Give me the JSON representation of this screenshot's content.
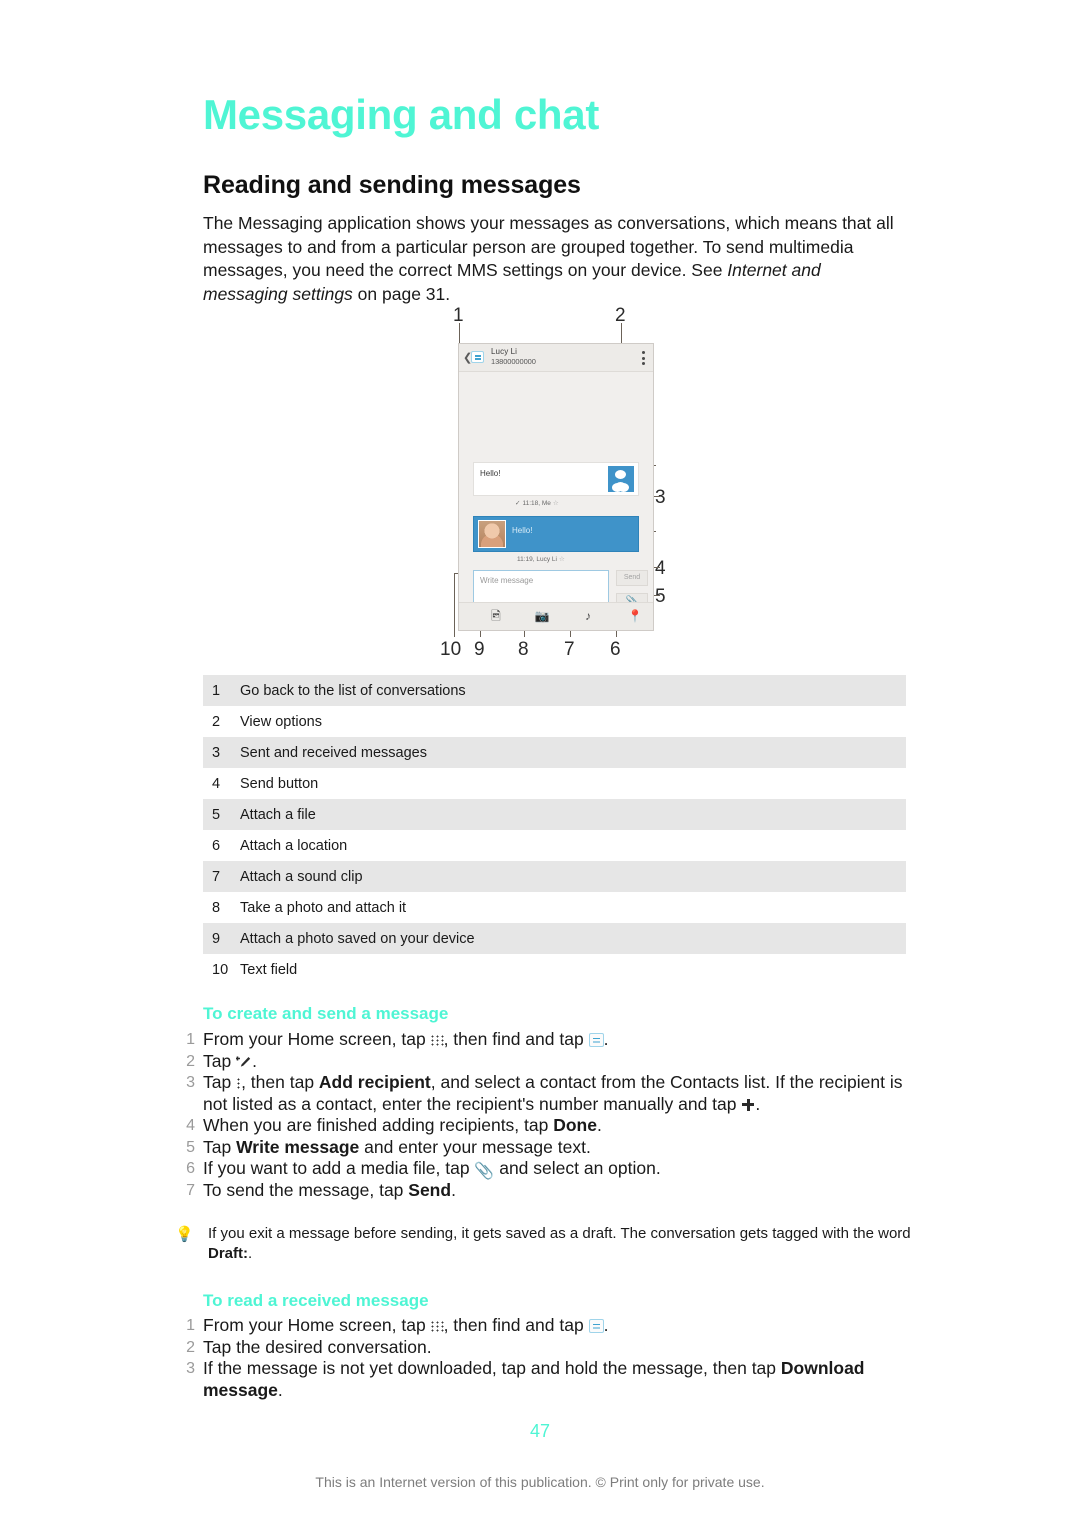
{
  "document": {
    "chapter_title": "Messaging and chat",
    "section_title": "Reading and sending messages",
    "intro_part1": "The Messaging application shows your messages as conversations, which means that all messages to and from a particular person are grouped together. To send multimedia messages, you need the correct MMS settings on your device. See ",
    "intro_italic": "Internet and messaging settings",
    "intro_part2": " on page 31.",
    "page_number": "47",
    "footer": "This is an Internet version of this publication. © Print only for private use."
  },
  "figure": {
    "callouts": [
      "1",
      "2",
      "3",
      "4",
      "5",
      "6",
      "7",
      "8",
      "9",
      "10"
    ],
    "phone": {
      "contact_name": "Lucy Li",
      "contact_number": "13800000000",
      "sent_message": "Hello!",
      "sent_meta": "11:18, Me",
      "received_message": "Hello!",
      "received_meta": "11:19, Lucy Li",
      "input_placeholder": "Write message",
      "send_label": "Send",
      "toolbar_icons": [
        "photo-icon",
        "camera-icon",
        "sound-icon",
        "location-icon"
      ]
    }
  },
  "legend": {
    "rows": [
      {
        "num": "1",
        "text": "Go back to the list of conversations"
      },
      {
        "num": "2",
        "text": "View options"
      },
      {
        "num": "3",
        "text": "Sent and received messages"
      },
      {
        "num": "4",
        "text": "Send button"
      },
      {
        "num": "5",
        "text": "Attach a file"
      },
      {
        "num": "6",
        "text": "Attach a location"
      },
      {
        "num": "7",
        "text": "Attach a sound clip"
      },
      {
        "num": "8",
        "text": "Take a photo and attach it"
      },
      {
        "num": "9",
        "text": "Attach a photo saved on your device"
      },
      {
        "num": "10",
        "text": "Text field"
      }
    ]
  },
  "procedure_create": {
    "title": "To create and send a message",
    "steps": {
      "s1_n": "1",
      "s1_a": "From your Home screen, tap ",
      "s1_b": ", then find and tap ",
      "s1_c": ".",
      "s2_n": "2",
      "s2_a": "Tap ",
      "s2_c": ".",
      "s3_n": "3",
      "s3_a": "Tap ",
      "s3_b": ", then tap ",
      "s3_bold": "Add recipient",
      "s3_c": ", and select a contact from the Contacts list. If the recipient is not listed as a contact, enter the recipient's number manually and tap ",
      "s3_d": ".",
      "s4_n": "4",
      "s4_a": "When you are finished adding recipients, tap ",
      "s4_bold": "Done",
      "s4_b": ".",
      "s5_n": "5",
      "s5_a": "Tap ",
      "s5_bold": "Write message",
      "s5_b": " and enter your message text.",
      "s6_n": "6",
      "s6_a": "If you want to add a media file, tap ",
      "s6_b": " and select an option.",
      "s7_n": "7",
      "s7_a": "To send the message, tap ",
      "s7_bold": "Send",
      "s7_b": "."
    }
  },
  "tip": {
    "icon": "lightbulb-icon",
    "text_a": "If you exit a message before sending, it gets saved as a draft. The conversation gets tagged with the word ",
    "text_bold": "Draft:",
    "text_b": "."
  },
  "procedure_read": {
    "title": "To read a received message",
    "steps": {
      "s1_n": "1",
      "s1_a": "From your Home screen, tap ",
      "s1_b": ", then find and tap ",
      "s1_c": ".",
      "s2_n": "2",
      "s2_text": "Tap the desired conversation.",
      "s3_n": "3",
      "s3_a": "If the message is not yet downloaded, tap and hold the message, then tap ",
      "s3_bold": "Download message",
      "s3_b": "."
    }
  },
  "colors": {
    "accent": "#4FF5D4",
    "bubble_blue": "#3F93C9",
    "row_shade": "#E6E6E6"
  }
}
